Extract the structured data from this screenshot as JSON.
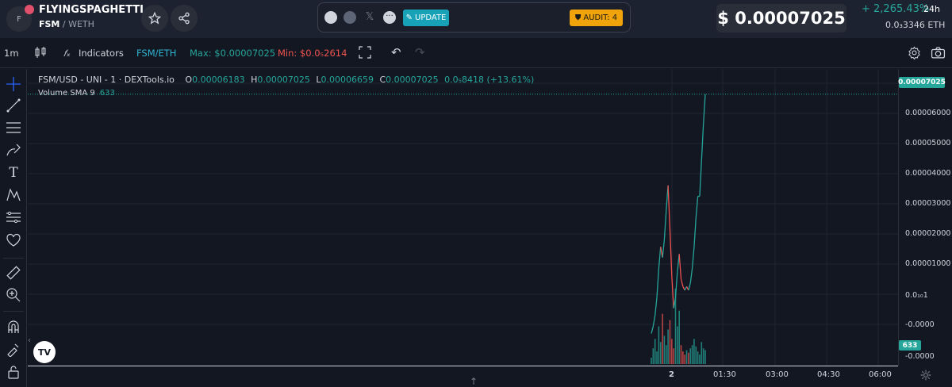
{
  "header": {
    "logo_letter": "F",
    "token_name": "FLYINGSPAGHETTI...",
    "pair_base": "FSM",
    "pair_quote": "/ WETH",
    "update_label": "UPDATE",
    "audit_label": "AUDIT: 4",
    "price": "$ 0.00007025",
    "change_pct": "+ 2,265.43%",
    "change_period": "24h",
    "eth_price": "0.0₃3346 ETH"
  },
  "toolbar": {
    "interval": "1m",
    "indicators_label": "Indicators",
    "pair_label": "FSM/ETH",
    "max_label": "Max: $0.00007025",
    "min_label": "Min: $0.0₅2614"
  },
  "legend": {
    "title": "FSM/USD - UNI - 1 · DEXTools.io",
    "o_key": "O",
    "o_val": "0.00006183",
    "h_key": "H",
    "h_val": "0.00007025",
    "l_key": "L",
    "l_val": "0.00006659",
    "c_key": "C",
    "c_val": "0.00007025",
    "change": "0.0₅8418 (+13.61%)",
    "volume_label": "Volume SMA 9",
    "volume_value": "633"
  },
  "price_axis": {
    "labels": [
      "0.00006000",
      "0.00005000",
      "0.00004000",
      "0.00003000",
      "0.00002000",
      "0.00001000",
      "0.0₁₀1",
      "-0.0000",
      "-0.0000"
    ],
    "last_price_tag": "0.00007025",
    "volume_tag": "633"
  },
  "time_axis": {
    "labels": [
      "2",
      "01:30",
      "03:00",
      "04:30",
      "06:00"
    ]
  },
  "colors": {
    "up": "#26a69a",
    "down": "#ef5350",
    "background": "#131722",
    "accent": "#17a2b8",
    "audit": "#f0a30a"
  },
  "chart_data": {
    "type": "line",
    "series": [
      {
        "values": [
          4e-06,
          6e-06,
          9e-06,
          1.4e-05,
          2.2e-05,
          2.8e-05,
          2.5e-05,
          3e-05,
          3.8e-05,
          4.5e-05,
          3.3e-05,
          2e-05,
          1.1e-05,
          1.4e-05,
          2.1e-05,
          2.6e-05,
          1.9e-05,
          1.7e-05,
          1.6e-05,
          1.7e-05,
          1.6e-05,
          1.8e-05,
          2.2e-05,
          2.8e-05,
          3.6e-05,
          4.2e-05,
          4.2e-05,
          5.2e-05,
          6.2e-05,
          7.025e-05
        ]
      }
    ],
    "volume": [
      10,
      25,
      40,
      20,
      60,
      35,
      80,
      45,
      30,
      55,
      70,
      40,
      25,
      120,
      60,
      85,
      30,
      20,
      15,
      22,
      18,
      25,
      30,
      40,
      28,
      20,
      15,
      35,
      25,
      22
    ],
    "ylim": [
      -4e-06,
      7.35e-05
    ]
  }
}
